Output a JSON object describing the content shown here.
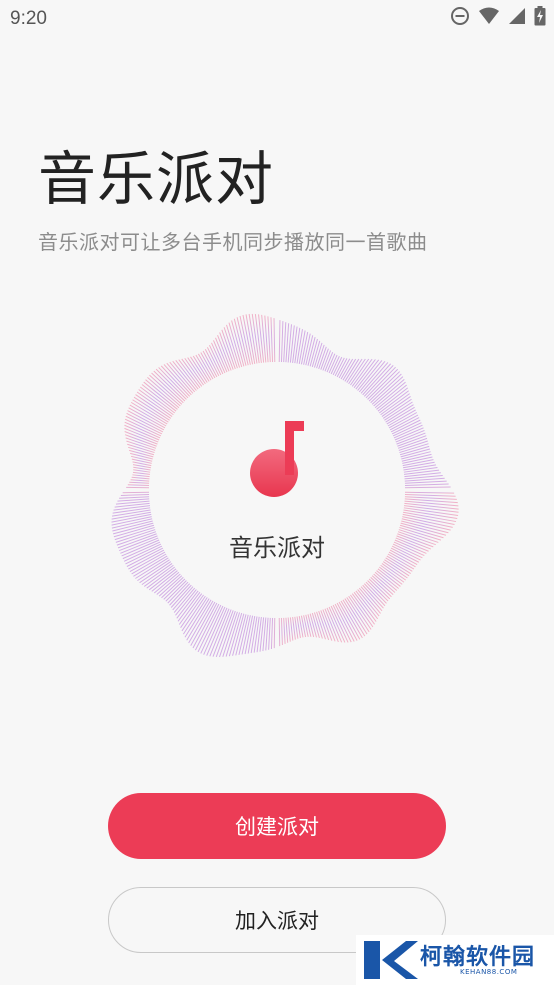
{
  "status_bar": {
    "time": "9:20",
    "icons": [
      "do-not-disturb-icon",
      "wifi-icon",
      "signal-icon",
      "battery-charging-icon"
    ]
  },
  "header": {
    "title": "音乐派对",
    "subtitle": "音乐派对可让多台手机同步播放同一首歌曲"
  },
  "visual": {
    "center_label": "音乐派对",
    "icon": "music-note-icon",
    "note_color": "#ec3c56",
    "wave_color_a": "#c9a0e6",
    "wave_color_b": "#f2a6bd"
  },
  "actions": {
    "create_label": "创建派对",
    "join_label": "加入派对",
    "accent_color": "#ec3c56"
  },
  "watermark": {
    "text": "柯翰软件园",
    "sub": "KEHAN88.COM"
  }
}
